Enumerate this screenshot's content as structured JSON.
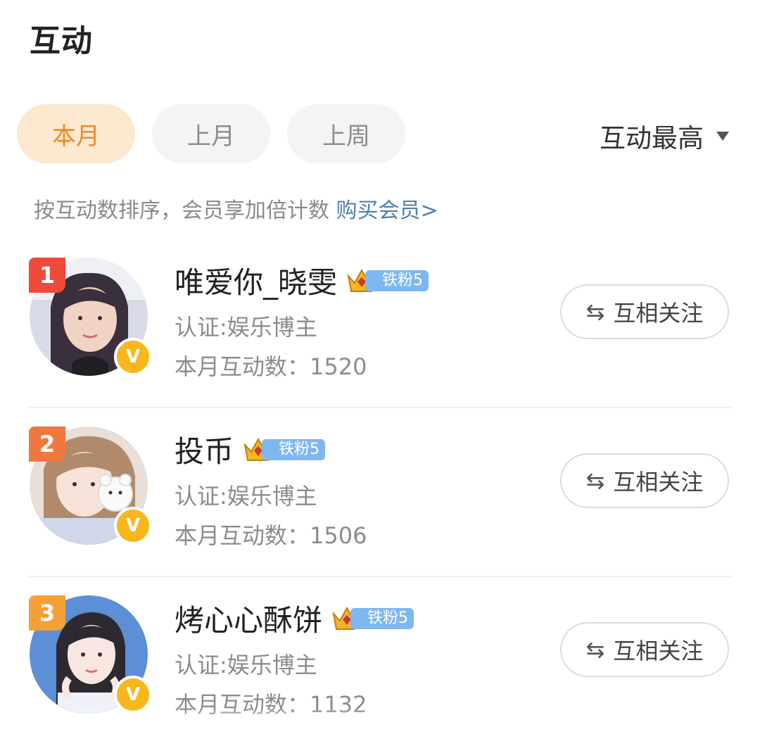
{
  "page": {
    "title": "互动"
  },
  "tabs": [
    {
      "label": "本月",
      "active": true
    },
    {
      "label": "上月",
      "active": false
    },
    {
      "label": "上周",
      "active": false
    }
  ],
  "sort": {
    "label": "互动最高",
    "icon": "caret-down-icon"
  },
  "hint": {
    "text": "按互动数排序，会员享加倍计数 ",
    "link": "购买会员>"
  },
  "colors": {
    "accent": "#ee8a2a",
    "rank1": "#f04a3a",
    "rank2": "#f07840",
    "rank3": "#f5a035",
    "fan_badge": "#7fb7f0",
    "verified": "#f7b71d",
    "link": "#4d7fb0"
  },
  "users": [
    {
      "rank": "1",
      "name": "唯爱你_晓雯",
      "fan_badge": "铁粉5",
      "crown_level": "4",
      "cert": "认证:娱乐博主",
      "interactions": "本月互动数：1520",
      "follow_label": "互相关注",
      "follow_icon": "⇆"
    },
    {
      "rank": "2",
      "name": "投币",
      "fan_badge": "铁粉5",
      "crown_level": "4",
      "cert": "认证:娱乐博主",
      "interactions": "本月互动数：1506",
      "follow_label": "互相关注",
      "follow_icon": "⇆"
    },
    {
      "rank": "3",
      "name": "烤心心酥饼",
      "fan_badge": "铁粉5",
      "crown_level": "3",
      "cert": "认证:娱乐博主",
      "interactions": "本月互动数：1132",
      "follow_label": "互相关注",
      "follow_icon": "⇆"
    }
  ]
}
